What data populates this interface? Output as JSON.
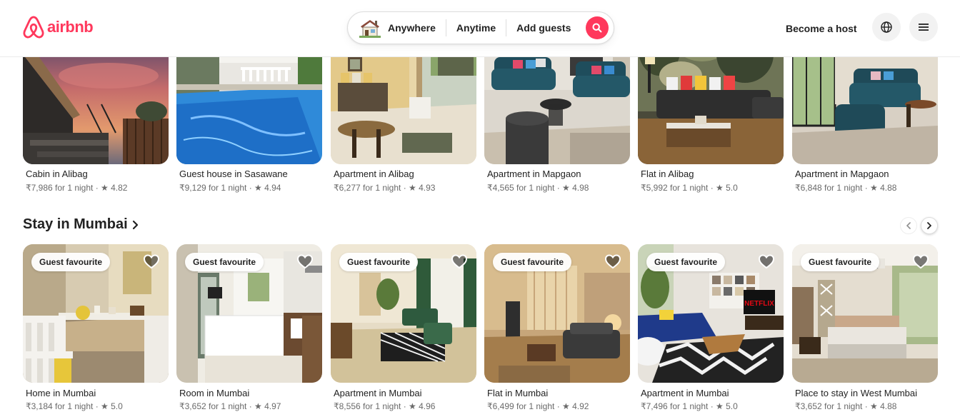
{
  "brand": {
    "name": "airbnb",
    "color": "#ff385c"
  },
  "search": {
    "where_label": "Anywhere",
    "when_label": "Anytime",
    "guests_label": "Add guests"
  },
  "header": {
    "host_label": "Become a host"
  },
  "icons": {
    "logo": "airbnb-logo-icon",
    "house": "house-icon",
    "search": "search-icon",
    "globe": "globe-icon",
    "menu": "menu-icon",
    "heart": "heart-icon",
    "chevron_right": "chevron-right-icon",
    "chevron_left": "chevron-left-icon"
  },
  "top_row": [
    {
      "title": "Cabin in Alibag",
      "meta": "₹7,986 for 1 night · ★ 4.82"
    },
    {
      "title": "Guest house in Sasawane",
      "meta": "₹9,129 for 1 night · ★ 4.94"
    },
    {
      "title": "Apartment in Alibag",
      "meta": "₹6,277 for 1 night · ★ 4.93"
    },
    {
      "title": "Apartment in Mapgaon",
      "meta": "₹4,565 for 1 night · ★ 4.98"
    },
    {
      "title": "Flat in Alibag",
      "meta": "₹5,992 for 1 night · ★ 5.0"
    },
    {
      "title": "Apartment in Mapgaon",
      "meta": "₹6,848 for 1 night · ★ 4.88"
    }
  ],
  "section": {
    "title": "Stay in Mumbai"
  },
  "mumbai_row": [
    {
      "badge": "Guest favourite",
      "title": "Home in Mumbai",
      "meta": "₹3,184 for 1 night · ★ 5.0"
    },
    {
      "badge": "Guest favourite",
      "title": "Room in Mumbai",
      "meta": "₹3,652 for 1 night · ★ 4.97"
    },
    {
      "badge": "Guest favourite",
      "title": "Apartment in Mumbai",
      "meta": "₹8,556 for 1 night · ★ 4.96"
    },
    {
      "badge": "Guest favourite",
      "title": "Flat in Mumbai",
      "meta": "₹6,499 for 1 night · ★ 4.92"
    },
    {
      "badge": "Guest favourite",
      "title": "Apartment in Mumbai",
      "meta": "₹7,496 for 1 night · ★ 5.0"
    },
    {
      "badge": "Guest favourite",
      "title": "Place to stay in West Mumbai",
      "meta": "₹3,652 for 1 night · ★ 4.88"
    }
  ],
  "tv_brand": "NETFLIX"
}
